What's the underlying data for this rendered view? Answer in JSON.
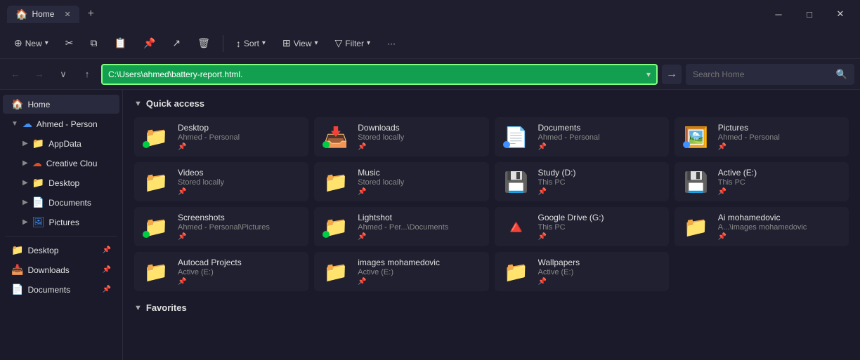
{
  "titleBar": {
    "tabLabel": "Home",
    "tabCloseLabel": "✕",
    "addTabLabel": "+",
    "minimizeLabel": "─",
    "maximizeLabel": "□",
    "closeLabel": "✕"
  },
  "toolbar": {
    "newLabel": "New",
    "sortLabel": "Sort",
    "viewLabel": "View",
    "filterLabel": "Filter",
    "moreLabel": "···"
  },
  "addressBar": {
    "backLabel": "←",
    "forwardLabel": "→",
    "dropdownLabel": "∨",
    "upLabel": "↑",
    "addressValue": "C:\\Users\\ahmed\\battery-report.html.",
    "goLabel": "→",
    "searchPlaceholder": "Search Home"
  },
  "sidebar": {
    "homeLabel": "Home",
    "ahmedPersonalLabel": "Ahmed - Person",
    "appDataLabel": "AppData",
    "creativeCloudLabel": "Creative Clou",
    "desktopLabel": "Desktop",
    "documentsLabel": "Documents",
    "picturesLabel": "Pictures",
    "desktop2Label": "Desktop",
    "downloadsLabel": "Downloads",
    "documents2Label": "Documents"
  },
  "quickAccess": {
    "sectionLabel": "Quick access",
    "items": [
      {
        "name": "Desktop",
        "sub": "Ahmed - Personal",
        "icon": "📁",
        "color": "#4090f0",
        "statusDot": "green"
      },
      {
        "name": "Downloads",
        "sub": "Stored locally",
        "icon": "📥",
        "color": "#00cc44",
        "statusDot": "green"
      },
      {
        "name": "Documents",
        "sub": "Ahmed - Personal",
        "icon": "📄",
        "color": "#4090f0",
        "statusDot": "blue"
      },
      {
        "name": "Pictures",
        "sub": "Ahmed - Personal",
        "icon": "🖼️",
        "color": "#4090f0",
        "statusDot": "blue"
      },
      {
        "name": "Videos",
        "sub": "Stored locally",
        "icon": "📁",
        "color": "#8a2be2",
        "statusDot": ""
      },
      {
        "name": "Music",
        "sub": "Stored locally",
        "icon": "📁",
        "color": "#e05020",
        "statusDot": ""
      },
      {
        "name": "Study (D:)",
        "sub": "This PC",
        "icon": "💾",
        "color": "",
        "statusDot": ""
      },
      {
        "name": "Active (E:)",
        "sub": "This PC",
        "icon": "💾",
        "color": "",
        "statusDot": ""
      },
      {
        "name": "Screenshots",
        "sub": "Ahmed - Personal\\Pictures",
        "icon": "📁",
        "color": "#e8a020",
        "statusDot": "green"
      },
      {
        "name": "Lightshot",
        "sub": "Ahmed - Per...\\Documents",
        "icon": "📁",
        "color": "#e8a020",
        "statusDot": "green"
      },
      {
        "name": "Google Drive (G:)",
        "sub": "This PC",
        "icon": "🔺",
        "color": "",
        "statusDot": ""
      },
      {
        "name": "Ai mohamedovic",
        "sub": "A...\\images mohamedovic",
        "icon": "📁",
        "color": "#e8a020",
        "statusDot": ""
      },
      {
        "name": "Autocad Projects",
        "sub": "Active (E:)",
        "icon": "📁",
        "color": "#e8a020",
        "statusDot": ""
      },
      {
        "name": "images mohamedovic",
        "sub": "Active (E:)",
        "icon": "📁",
        "color": "#e8a020",
        "statusDot": ""
      },
      {
        "name": "Wallpapers",
        "sub": "Active (E:)",
        "icon": "📁",
        "color": "#e8a020",
        "statusDot": ""
      }
    ]
  },
  "favorites": {
    "sectionLabel": "Favorites"
  }
}
